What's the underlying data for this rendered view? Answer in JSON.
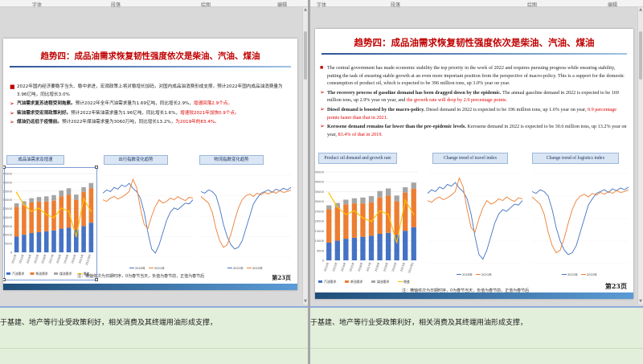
{
  "ribbon_left": [
    "字体",
    "段落",
    "绘图",
    "编辑"
  ],
  "ribbon_right": [
    "字体",
    "段落",
    "绘图",
    "编辑"
  ],
  "left_slide": {
    "title": "趋势四：成品油需求恢复韧性强度依次是柴油、汽油、煤油",
    "bullets": [
      {
        "marker": "■",
        "parts": [
          {
            "t": "2022年国内经济要稳字当头、稳中求进，宏观政策上将对稳增长加码，对国内成品油消费形成支撑，预计2022年国内成品油消费量为3.96亿吨，同比增长3.0%",
            "s": "n"
          }
        ]
      },
      {
        "marker": "➢",
        "parts": [
          {
            "t": "汽油需求复苏进程受到拖累。",
            "s": "b"
          },
          {
            "t": "预计2022年全年汽油需求量为1.69亿吨，同比增长2.9%，",
            "s": "n"
          },
          {
            "t": "增速回落2.9个点。",
            "s": "r"
          }
        ]
      },
      {
        "marker": "➢",
        "parts": [
          {
            "t": "柴油需求受宏观政策利好。",
            "s": "b"
          },
          {
            "t": "预计2022年柴油需求量为1.96亿吨，同比增长1.6%，",
            "s": "n"
          },
          {
            "t": "增速较2021年加快0.9个点。",
            "s": "r"
          }
        ]
      },
      {
        "marker": "➢",
        "parts": [
          {
            "t": "煤油仍远低于疫情前。",
            "s": "b"
          },
          {
            "t": "预计2022年煤油需求量为3060万吨，同比增长13.2%，",
            "s": "n"
          },
          {
            "t": "为2019年的83.4%。",
            "s": "r"
          }
        ]
      }
    ],
    "tabs": [
      "成品油需求及增速",
      "出行指数变化趋势",
      "物流指数变化趋势"
    ],
    "legend": [
      "汽油需求",
      "柴油需求",
      "煤油需求",
      "增速"
    ],
    "source": "注：横轴依次为日期时序，0为春节当天，负值为春节前，正值为春节后",
    "page_no": "第23页"
  },
  "right_slide": {
    "title": "趋势四：成品油需求恢复韧性强度依次是柴油、汽油、煤油",
    "bullets": [
      {
        "marker": "■",
        "parts": [
          {
            "t": "The central government has made economic stability the top priority in the work of 2022 and requires pursuing progress while ensuring stability, putting the task of ensuring stable growth at an even more important position from the perspective of macro-policy. This is a support for the domestic consumption of product oil, which is expected to be 396 million tons, up 3.0% year on year.",
            "s": "n"
          }
        ]
      },
      {
        "marker": "➢",
        "parts": [
          {
            "t": "The recovery process of gasoline demand has been dragged down by the epidemic.",
            "s": "b"
          },
          {
            "t": " The annual gasoline demand in 2022 is expected to be 169 million tons, up 2.9% year on year, and ",
            "s": "n"
          },
          {
            "t": "the growth rate will drop by 2.9 percentage points.",
            "s": "r"
          }
        ]
      },
      {
        "marker": "➢",
        "parts": [
          {
            "t": "Diesel demand is boosted by the macro-policy.",
            "s": "b"
          },
          {
            "t": " Diesel demand in 2022 is expected to be 196 million tons, up 1.6% year on year, ",
            "s": "n"
          },
          {
            "t": "0.9 percentage points faster than that in 2021.",
            "s": "r"
          }
        ]
      },
      {
        "marker": "➢",
        "parts": [
          {
            "t": "Kerosene demand remains far lower than the pre-epidemic levels.",
            "s": "b"
          },
          {
            "t": " Kerosene demand in 2022 is expected to be 30.6 million tons, up 13.2% year on year, ",
            "s": "n"
          },
          {
            "t": "83.4% of that in 2019.",
            "s": "r"
          }
        ]
      }
    ],
    "tabs": [
      "Product oil demand and growth rate",
      "Change trend of travel index",
      "Change trend of logistics index"
    ],
    "legend": [
      "汽油需求",
      "柴油需求",
      "煤油需求",
      "增速"
    ],
    "source": "注：横轴依次为日期时序，0为春节当天，负值为春节前，正值为春节后",
    "page_no": "第23页"
  },
  "notes_left": "于基建、地产等行业受政策利好，相关消费及其终端用油形成支撑，",
  "notes_right": "于基建、地产等行业受政策利好，相关消费及其终端用油形成支撑，",
  "chart_data": [
    {
      "type": "bar",
      "title": "成品油需求及增速",
      "categories": [
        "2012年",
        "2013年",
        "2014年",
        "2015年",
        "2016年",
        "2017年",
        "2018年",
        "2019年",
        "2020年",
        "2021年",
        "2022年E"
      ],
      "series": [
        {
          "name": "汽油需求",
          "values": [
            9000,
            10000,
            11000,
            11500,
            12000,
            12500,
            13500,
            14000,
            13000,
            15000,
            16900
          ]
        },
        {
          "name": "柴油需求",
          "values": [
            17000,
            17000,
            17500,
            17500,
            17000,
            17000,
            18500,
            19000,
            17000,
            19500,
            19600
          ]
        },
        {
          "name": "煤油需求",
          "values": [
            2000,
            2200,
            2400,
            2600,
            3000,
            3200,
            3300,
            3600,
            3000,
            2700,
            3060
          ]
        }
      ],
      "growth": {
        "name": "增速",
        "values": [
          9,
          5,
          3,
          4,
          2,
          1,
          4,
          3,
          -5,
          7,
          3
        ]
      },
      "ylim": [
        0,
        45000
      ],
      "yticks": [
        "0",
        "5000",
        "10000",
        "15000",
        "20000",
        "25000",
        "30000",
        "35000",
        "40000",
        "45000"
      ],
      "legend_position": "bottom"
    },
    {
      "type": "line",
      "title": "出行指数变化趋势",
      "legend_position": "bottom",
      "series": [
        {
          "name": "2020年",
          "values": [
            0.78,
            0.82,
            0.8,
            0.85,
            0.83,
            0.88,
            0.86,
            0.9,
            0.84,
            0.8,
            0.72,
            0.55,
            0.3,
            0.1,
            0.05,
            0.15,
            0.3,
            0.45,
            0.55,
            0.6,
            0.58,
            0.62,
            0.66,
            0.65,
            0.7
          ]
        },
        {
          "name": "2021年",
          "values": [
            0.7,
            0.68,
            0.72,
            0.74,
            0.71,
            0.73,
            0.76,
            0.8,
            0.95,
            0.85,
            0.6,
            0.4,
            0.35,
            0.5,
            0.62,
            0.7,
            0.66,
            0.68,
            0.72,
            0.7,
            0.74,
            0.71,
            0.69,
            0.73,
            0.72
          ]
        }
      ]
    },
    {
      "type": "line",
      "title": "物流指数变化趋势",
      "legend_position": "bottom",
      "series": [
        {
          "name": "2021年",
          "values": [
            0.8,
            0.78,
            0.82,
            0.8,
            0.75,
            0.6,
            0.4,
            0.25,
            0.15,
            0.1,
            0.12,
            0.2,
            0.35,
            0.5,
            0.65,
            0.72,
            0.78,
            0.8,
            0.82,
            0.79,
            0.83,
            0.81,
            0.84,
            0.82,
            0.85
          ]
        },
        {
          "name": "2022年",
          "values": [
            0.74,
            0.7,
            0.66,
            0.55,
            0.35,
            0.2,
            0.12,
            0.15,
            0.28,
            0.45,
            0.6,
            0.7,
            0.75,
            0.77,
            0.74,
            0.78,
            0.76,
            0.79,
            0.77,
            0.8,
            0.78,
            0.81,
            0.79,
            0.8,
            0.82
          ]
        }
      ]
    }
  ],
  "colors": {
    "gasoline": "#4472c4",
    "diesel": "#ed7d31",
    "kerosene": "#a5a5a5",
    "growth": "#ffc000",
    "title_red": "#c00000",
    "notes_bg": "#e2efda",
    "tab_bg": "#dbe6f4"
  }
}
